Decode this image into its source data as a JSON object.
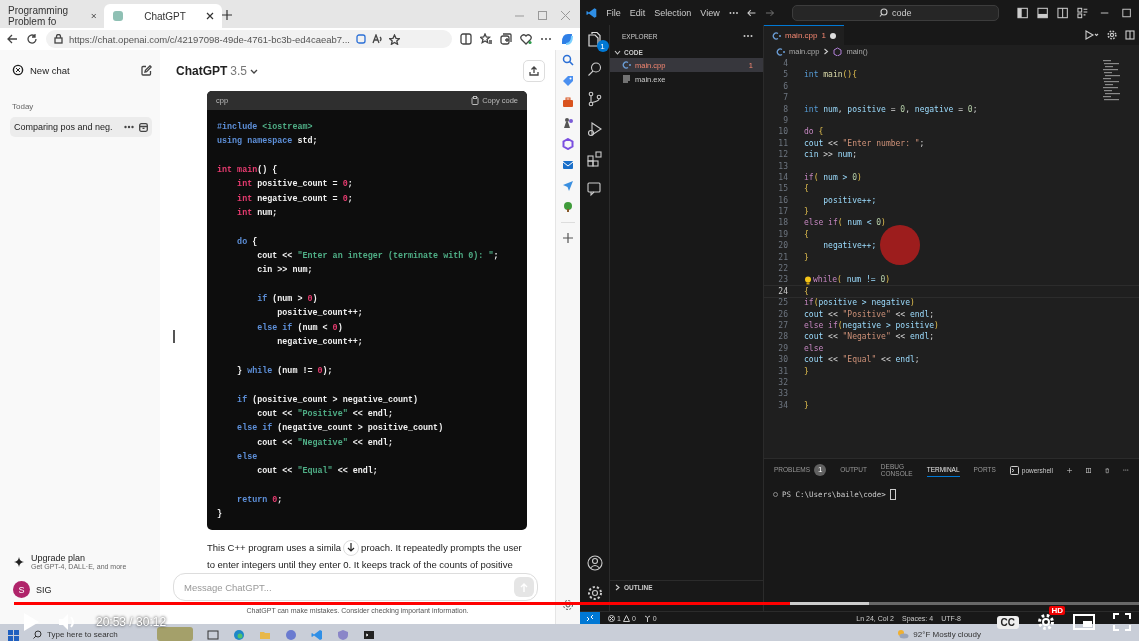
{
  "browser": {
    "tabs": [
      {
        "label": "Programming Problem fo",
        "selected": false
      },
      {
        "label": "ChatGPT",
        "selected": true
      }
    ],
    "url": "https://chat.openai.com/c/42197098-49de-4761-bc3b-ed4caeab7...",
    "sidebar": {
      "new_chat": "New chat",
      "section": "Today",
      "conversations": [
        {
          "title": "Comparing pos and neg.",
          "selected": true
        }
      ],
      "upgrade": {
        "title": "Upgrade plan",
        "subtitle": "Get GPT-4, DALL·E, and more"
      },
      "user": {
        "initial": "S",
        "name": "SIG"
      }
    },
    "model": {
      "name": "ChatGPT",
      "version": "3.5"
    },
    "code_block": {
      "language": "cpp",
      "copy_label": "Copy code",
      "blocks": [
        {
          "lines": [
            {
              "tokens": [
                {
                  "text": "#include",
                  "kind": "keyword"
                },
                {
                  "text": " <iostream>",
                  "kind": "string"
                }
              ]
            },
            {
              "tokens": [
                {
                  "text": "using namespace",
                  "kind": "keyword"
                },
                {
                  "text": " std;",
                  "kind": "plain"
                }
              ]
            }
          ]
        },
        {
          "lines": [
            {
              "tokens": [
                {
                  "text": "int",
                  "kind": "type"
                },
                {
                  "text": " main",
                  "kind": "type"
                },
                {
                  "text": "() {",
                  "kind": "plain"
                }
              ]
            },
            {
              "tokens": [
                {
                  "text": "    int",
                  "kind": "type"
                },
                {
                  "text": " positive_count = ",
                  "kind": "plain"
                },
                {
                  "text": "0",
                  "kind": "number"
                },
                {
                  "text": ";",
                  "kind": "plain"
                }
              ]
            },
            {
              "tokens": [
                {
                  "text": "    int",
                  "kind": "type"
                },
                {
                  "text": " negative_count = ",
                  "kind": "plain"
                },
                {
                  "text": "0",
                  "kind": "number"
                },
                {
                  "text": ";",
                  "kind": "plain"
                }
              ]
            },
            {
              "tokens": [
                {
                  "text": "    int",
                  "kind": "type"
                },
                {
                  "text": " num;",
                  "kind": "plain"
                }
              ]
            }
          ]
        },
        {
          "lines": [
            {
              "tokens": [
                {
                  "text": "    do",
                  "kind": "keyword"
                },
                {
                  "text": " {",
                  "kind": "plain"
                }
              ]
            },
            {
              "tokens": [
                {
                  "text": "        cout << ",
                  "kind": "plain"
                },
                {
                  "text": "\"Enter an integer (terminate with 0): \"",
                  "kind": "string"
                },
                {
                  "text": ";",
                  "kind": "plain"
                }
              ]
            },
            {
              "tokens": [
                {
                  "text": "        cin >> num;",
                  "kind": "plain"
                }
              ]
            }
          ]
        },
        {
          "lines": [
            {
              "tokens": [
                {
                  "text": "        if",
                  "kind": "keyword"
                },
                {
                  "text": " (num > ",
                  "kind": "plain"
                },
                {
                  "text": "0",
                  "kind": "number"
                },
                {
                  "text": ")",
                  "kind": "plain"
                }
              ]
            },
            {
              "tokens": [
                {
                  "text": "            positive_count++;",
                  "kind": "plain"
                }
              ]
            },
            {
              "tokens": [
                {
                  "text": "        else if",
                  "kind": "keyword"
                },
                {
                  "text": " (num < ",
                  "kind": "plain"
                },
                {
                  "text": "0",
                  "kind": "number"
                },
                {
                  "text": ")",
                  "kind": "plain"
                }
              ]
            },
            {
              "tokens": [
                {
                  "text": "            negative_count++;",
                  "kind": "plain"
                }
              ]
            }
          ]
        },
        {
          "lines": [
            {
              "tokens": [
                {
                  "text": "    }",
                  "kind": "plain"
                },
                {
                  "text": " while",
                  "kind": "keyword"
                },
                {
                  "text": " (num != ",
                  "kind": "plain"
                },
                {
                  "text": "0",
                  "kind": "number"
                },
                {
                  "text": ");",
                  "kind": "plain"
                }
              ]
            }
          ]
        },
        {
          "lines": [
            {
              "tokens": [
                {
                  "text": "    if",
                  "kind": "keyword"
                },
                {
                  "text": " (positive_count > negative_count)",
                  "kind": "plain"
                }
              ]
            },
            {
              "tokens": [
                {
                  "text": "        cout << ",
                  "kind": "plain"
                },
                {
                  "text": "\"Positive\"",
                  "kind": "string"
                },
                {
                  "text": " << endl;",
                  "kind": "plain"
                }
              ]
            },
            {
              "tokens": [
                {
                  "text": "    else if",
                  "kind": "keyword"
                },
                {
                  "text": " (negative_count > positive_count)",
                  "kind": "plain"
                }
              ]
            },
            {
              "tokens": [
                {
                  "text": "        cout << ",
                  "kind": "plain"
                },
                {
                  "text": "\"Negative\"",
                  "kind": "string"
                },
                {
                  "text": " << endl;",
                  "kind": "plain"
                }
              ]
            },
            {
              "tokens": [
                {
                  "text": "    else",
                  "kind": "keyword"
                }
              ]
            },
            {
              "tokens": [
                {
                  "text": "        cout << ",
                  "kind": "plain"
                },
                {
                  "text": "\"Equal\"",
                  "kind": "string"
                },
                {
                  "text": " << endl;",
                  "kind": "plain"
                }
              ]
            }
          ]
        },
        {
          "lines": [
            {
              "tokens": [
                {
                  "text": "    return",
                  "kind": "keyword"
                },
                {
                  "text": " 0",
                  "kind": "number"
                },
                {
                  "text": ";",
                  "kind": "plain"
                }
              ]
            },
            {
              "tokens": [
                {
                  "text": "}",
                  "kind": "plain"
                }
              ]
            }
          ]
        }
      ]
    },
    "reply_first_line": [
      "This C++ program uses a simila",
      "proach. It repeatedly prompts the user"
    ],
    "reply_second_line": "to enter integers until they enter 0. It keeps track of the counts of positive",
    "message_placeholder": "Message ChatGPT...",
    "disclaimer": "ChatGPT can make mistakes. Consider checking important information."
  },
  "vscode": {
    "menu": [
      "File",
      "Edit",
      "Selection",
      "View"
    ],
    "search": "code",
    "activity_badge": "1",
    "explorer": {
      "title": "EXPLORER",
      "folder": "CODE",
      "files": [
        {
          "name": "main.cpp",
          "kind": "cpp",
          "badge": "1",
          "error": true,
          "selected": true
        },
        {
          "name": "main.exe",
          "kind": "exe",
          "error": false,
          "selected": false
        }
      ],
      "sections": [
        "OUTLINE"
      ]
    },
    "editor_tab": {
      "name": "main.cpp",
      "badge": "1",
      "modified": true
    },
    "breadcrumbs": [
      "main.cpp",
      "main()"
    ],
    "lines": [
      {
        "number": "4",
        "active": false
      },
      {
        "number": "5",
        "active": false,
        "tokens": [
          {
            "text": "int",
            "kind": "type"
          },
          {
            "text": " main",
            "kind": "function"
          },
          {
            "text": "(){",
            "kind": "bracket"
          }
        ]
      },
      {
        "number": "6",
        "active": false
      },
      {
        "number": "7",
        "active": false
      },
      {
        "number": "8",
        "active": false,
        "tokens": [
          {
            "text": "int",
            "kind": "type"
          },
          {
            "text": " num",
            "kind": "variable"
          },
          {
            "text": ", ",
            "kind": "plain"
          },
          {
            "text": "positive",
            "kind": "variable"
          },
          {
            "text": " = ",
            "kind": "plain"
          },
          {
            "text": "0",
            "kind": "number"
          },
          {
            "text": ", ",
            "kind": "plain"
          },
          {
            "text": "negative",
            "kind": "variable"
          },
          {
            "text": " = ",
            "kind": "plain"
          },
          {
            "text": "0",
            "kind": "number"
          },
          {
            "text": ";",
            "kind": "plain"
          }
        ]
      },
      {
        "number": "9",
        "active": false
      },
      {
        "number": "10",
        "active": false,
        "tokens": [
          {
            "text": "do",
            "kind": "keyword"
          },
          {
            "text": " {",
            "kind": "bracket"
          }
        ]
      },
      {
        "number": "11",
        "active": false,
        "tokens": [
          {
            "text": "cout",
            "kind": "variable"
          },
          {
            "text": " << ",
            "kind": "plain"
          },
          {
            "text": "\"Enter number: \"",
            "kind": "string"
          },
          {
            "text": ";",
            "kind": "plain"
          }
        ]
      },
      {
        "number": "12",
        "active": false,
        "tokens": [
          {
            "text": "cin",
            "kind": "variable"
          },
          {
            "text": " >> ",
            "kind": "plain"
          },
          {
            "text": "num",
            "kind": "variable"
          },
          {
            "text": ";",
            "kind": "plain"
          }
        ]
      },
      {
        "number": "13",
        "active": false
      },
      {
        "number": "14",
        "active": false,
        "tokens": [
          {
            "text": "if",
            "kind": "keyword"
          },
          {
            "text": "(",
            "kind": "bracket"
          },
          {
            "text": " num > ",
            "kind": "variable"
          },
          {
            "text": "0",
            "kind": "number"
          },
          {
            "text": ")",
            "kind": "bracket"
          }
        ]
      },
      {
        "number": "15",
        "active": false,
        "tokens": [
          {
            "text": "{",
            "kind": "bracket"
          }
        ]
      },
      {
        "number": "16",
        "active": false,
        "tokens": [
          {
            "text": "    positive++;",
            "kind": "variable"
          }
        ]
      },
      {
        "number": "17",
        "active": false,
        "tokens": [
          {
            "text": "}",
            "kind": "bracket"
          }
        ]
      },
      {
        "number": "18",
        "active": false,
        "tokens": [
          {
            "text": "else if",
            "kind": "keyword"
          },
          {
            "text": "(",
            "kind": "bracket"
          },
          {
            "text": " num < ",
            "kind": "variable"
          },
          {
            "text": "0",
            "kind": "number"
          },
          {
            "text": ")",
            "kind": "bracket"
          }
        ]
      },
      {
        "number": "19",
        "active": false,
        "tokens": [
          {
            "text": "{",
            "kind": "bracket"
          }
        ]
      },
      {
        "number": "20",
        "active": false,
        "tokens": [
          {
            "text": "    negative++;",
            "kind": "variable"
          }
        ]
      },
      {
        "number": "21",
        "active": false,
        "tokens": [
          {
            "text": "}",
            "kind": "bracket"
          }
        ]
      },
      {
        "number": "22",
        "active": false
      },
      {
        "number": "23",
        "active": false,
        "lightbulb": true,
        "tokens": [
          {
            "text": "while",
            "kind": "keyword"
          },
          {
            "text": "(",
            "kind": "bracket"
          },
          {
            "text": " num != ",
            "kind": "variable"
          },
          {
            "text": "0",
            "kind": "number"
          },
          {
            "text": ")",
            "kind": "bracket"
          }
        ]
      },
      {
        "number": "24",
        "active": true,
        "tokens": [
          {
            "text": "{",
            "kind": "bracket"
          }
        ]
      },
      {
        "number": "25",
        "active": false,
        "tokens": [
          {
            "text": "if",
            "kind": "keyword"
          },
          {
            "text": "(",
            "kind": "bracket"
          },
          {
            "text": "positive > negative",
            "kind": "variable"
          },
          {
            "text": ")",
            "kind": "bracket"
          }
        ]
      },
      {
        "number": "26",
        "active": false,
        "tokens": [
          {
            "text": "cout",
            "kind": "variable"
          },
          {
            "text": " << ",
            "kind": "plain"
          },
          {
            "text": "\"Positive\"",
            "kind": "string"
          },
          {
            "text": " << ",
            "kind": "plain"
          },
          {
            "text": "endl",
            "kind": "variable"
          },
          {
            "text": ";",
            "kind": "plain"
          }
        ]
      },
      {
        "number": "27",
        "active": false,
        "tokens": [
          {
            "text": "else if",
            "kind": "keyword"
          },
          {
            "text": "(",
            "kind": "bracket"
          },
          {
            "text": "negative > positive",
            "kind": "variable"
          },
          {
            "text": ")",
            "kind": "bracket"
          }
        ]
      },
      {
        "number": "28",
        "active": false,
        "tokens": [
          {
            "text": "cout",
            "kind": "variable"
          },
          {
            "text": " << ",
            "kind": "plain"
          },
          {
            "text": "\"Negative\"",
            "kind": "string"
          },
          {
            "text": " << ",
            "kind": "plain"
          },
          {
            "text": "endl",
            "kind": "variable"
          },
          {
            "text": ";",
            "kind": "plain"
          }
        ]
      },
      {
        "number": "29",
        "active": false,
        "tokens": [
          {
            "text": "else",
            "kind": "keyword"
          }
        ]
      },
      {
        "number": "30",
        "active": false,
        "tokens": [
          {
            "text": "cout",
            "kind": "variable"
          },
          {
            "text": " << ",
            "kind": "plain"
          },
          {
            "text": "\"Equal\"",
            "kind": "string"
          },
          {
            "text": " << ",
            "kind": "plain"
          },
          {
            "text": "endl",
            "kind": "variable"
          },
          {
            "text": ";",
            "kind": "plain"
          }
        ]
      },
      {
        "number": "31",
        "active": false,
        "tokens": [
          {
            "text": "}",
            "kind": "bracket"
          }
        ]
      },
      {
        "number": "32",
        "active": false
      },
      {
        "number": "33",
        "active": false
      },
      {
        "number": "34",
        "active": false,
        "tokens": [
          {
            "text": "}",
            "kind": "bracket"
          }
        ]
      }
    ],
    "panel": {
      "tabs": [
        {
          "label": "PROBLEMS",
          "badge": "1",
          "selected": false
        },
        {
          "label": "OUTPUT",
          "selected": false
        },
        {
          "label": "DEBUG CONSOLE",
          "selected": false
        },
        {
          "label": "TERMINAL",
          "selected": true
        },
        {
          "label": "PORTS",
          "selected": false
        }
      ],
      "shell": "powershell",
      "prompt": "PS C:\\Users\\baile\\code>"
    },
    "status": {
      "errors": "1",
      "warnings": "0",
      "ports": "0",
      "items": [
        "Ln 24, Col 2",
        "Spaces: 4",
        "UTF-8"
      ]
    }
  },
  "player": {
    "progress": {
      "level": 0.69
    },
    "buffer": {
      "level": 0.76
    },
    "time": "20:53 / 30:12",
    "captions": "CC",
    "quality": "HD"
  },
  "taskbar": {
    "search_placeholder": "Type here to search",
    "weather": "92°F  Mostly cloudy"
  }
}
